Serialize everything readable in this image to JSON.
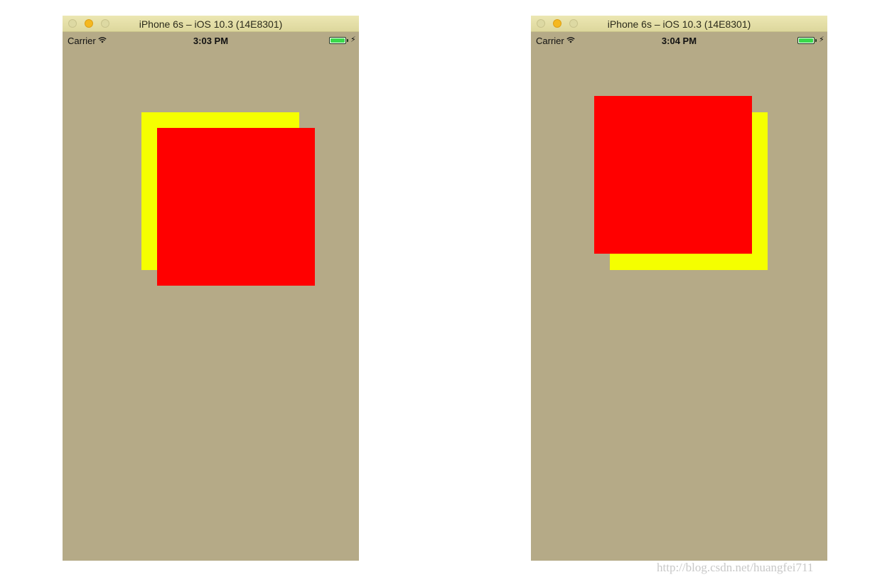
{
  "simulators": [
    {
      "title": "iPhone 6s – iOS 10.3 (14E8301)",
      "status_bar": {
        "carrier": "Carrier",
        "time": "3:03 PM",
        "battery_level": 1.0,
        "charging": true
      }
    },
    {
      "title": "iPhone 6s – iOS 10.3 (14E8301)",
      "status_bar": {
        "carrier": "Carrier",
        "time": "3:04 PM",
        "battery_level": 1.0,
        "charging": true
      }
    }
  ],
  "icons": {
    "wifi": "wifi-icon",
    "battery": "battery-icon",
    "charging": "charging-bolt-icon",
    "close": "close-light",
    "minimize": "minimize-light",
    "zoom": "zoom-light"
  },
  "colors": {
    "screen_background": "#b5aa87",
    "yellow_view": "#f5ff00",
    "red_view": "#ff0000",
    "title_bar": "#e6e0aa",
    "battery_fill": "#39d94b",
    "minimize_light": "#f5b820"
  },
  "watermark": "http://blog.csdn.net/huangfei711"
}
